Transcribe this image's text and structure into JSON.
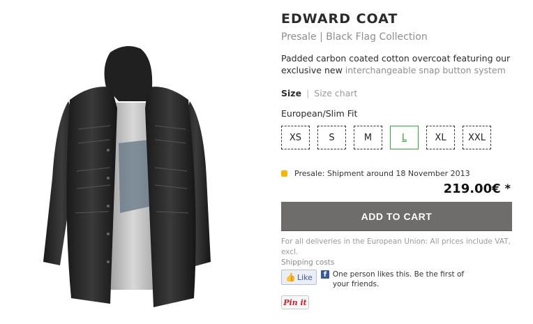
{
  "product": {
    "title": "EDWARD COAT",
    "subtitle": "Presale | Black Flag Collection",
    "description_main": "Padded carbon coated cotton overcoat featuring our exclusive new ",
    "description_highlight": "interchangeable snap button system",
    "image_icon": "coat-image"
  },
  "size": {
    "label": "Size",
    "separator": "|",
    "chart_link": "Size chart",
    "fit_label": "European/Slim Fit",
    "options": [
      "XS",
      "S",
      "M",
      "L",
      "XL",
      "XXL"
    ],
    "selected": "L"
  },
  "presale_notice": "Presale: Shipment around 18 November 2013",
  "price": {
    "amount": "219.00€",
    "marker": "*"
  },
  "cart": {
    "button_label": "ADD TO CART"
  },
  "vat_note": "For all deliveries in the European Union: All prices include VAT, excl.",
  "shipping_link": "Shipping costs",
  "social": {
    "like_label": "Like",
    "like_text": "One person likes this. Be the first of your friends.",
    "pin_label": "Pin it"
  },
  "colors": {
    "accent_selected": "#3aa23a",
    "cart_button": "#6f6c6c",
    "presale_dot": "#f5b800",
    "facebook": "#3b5998",
    "pinterest": "#cb2027"
  }
}
